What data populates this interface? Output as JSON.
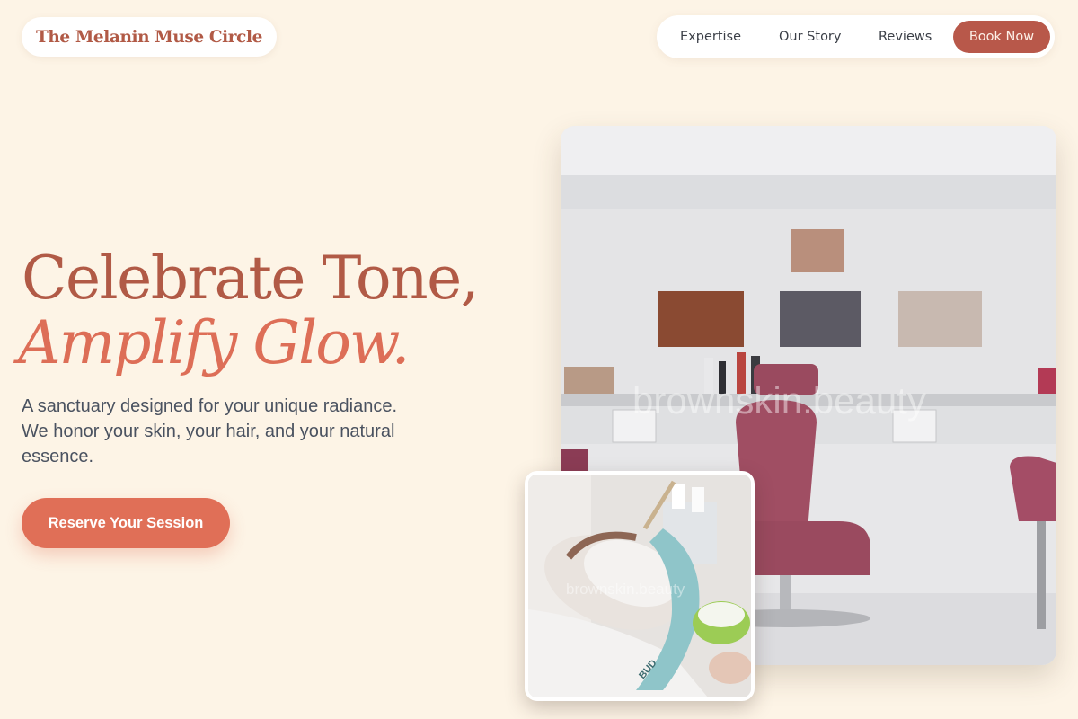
{
  "brand": {
    "name": "The Melanin Muse Circle"
  },
  "nav": {
    "links": [
      "Expertise",
      "Our Story",
      "Reviews"
    ],
    "book_label": "Book Now"
  },
  "hero": {
    "headline_line1": "Celebrate Tone,",
    "headline_line2": "Amplify Glow.",
    "subtitle": "A sanctuary designed for your unique radiance. We honor your skin, your hair, and your natural essence.",
    "cta_label": "Reserve Your Session"
  },
  "images": {
    "main_watermark": "brownskin.beauty",
    "inset_watermark": "brownskin.beauty",
    "inset_headband_text": "BUD"
  },
  "colors": {
    "background": "#fdf4e6",
    "brand_text": "#b15a46",
    "accent": "#e06f57",
    "book_button": "#b8584a",
    "body_text": "#4a5260"
  }
}
